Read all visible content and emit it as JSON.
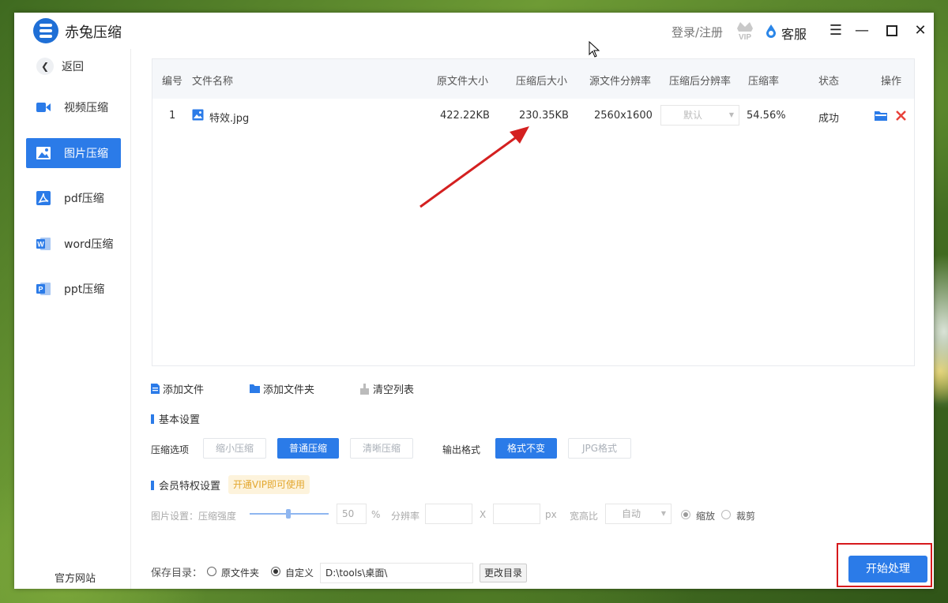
{
  "app": {
    "title": "赤兔压缩"
  },
  "header": {
    "login_label": "登录/注册",
    "vip_label": "VIP",
    "service_label": "客服"
  },
  "sidebar": {
    "back_label": "返回",
    "items": [
      {
        "label": "视频压缩",
        "icon": "video-icon"
      },
      {
        "label": "图片压缩",
        "icon": "image-icon",
        "active": true
      },
      {
        "label": "pdf压缩",
        "icon": "pdf-icon"
      },
      {
        "label": "word压缩",
        "icon": "word-icon"
      },
      {
        "label": "ppt压缩",
        "icon": "ppt-icon"
      }
    ],
    "footer_link": "官方网站"
  },
  "table": {
    "columns": [
      "编号",
      "文件名称",
      "原文件大小",
      "压缩后大小",
      "源文件分辨率",
      "压缩后分辨率",
      "压缩率",
      "状态",
      "操作"
    ],
    "rows": [
      {
        "index": "1",
        "filename": "特效.jpg",
        "original_size": "422.22KB",
        "compressed_size": "230.35KB",
        "source_resolution": "2560x1600",
        "target_resolution": "默认",
        "ratio": "54.56%",
        "status": "成功"
      }
    ]
  },
  "toolbar": {
    "add_file": "添加文件",
    "add_folder": "添加文件夹",
    "clear_list": "清空列表"
  },
  "basic_settings": {
    "title": "基本设置",
    "compress_label": "压缩选项",
    "compress_options": [
      "缩小压缩",
      "普通压缩",
      "清晰压缩"
    ],
    "compress_selected": "普通压缩",
    "format_label": "输出格式",
    "format_options": [
      "格式不变",
      "JPG格式"
    ],
    "format_selected": "格式不变"
  },
  "vip_settings": {
    "title": "会员特权设置",
    "tag": "开通VIP即可使用",
    "image_label": "图片设置：压缩强度",
    "strength_value": "50",
    "percent_unit": "%",
    "resolution_label": "分辨率",
    "x_label": "X",
    "px_unit": "px",
    "aspect_label": "宽高比",
    "aspect_value": "自动",
    "scale_label": "缩放",
    "crop_label": "裁剪",
    "slider_level": 0.5
  },
  "save": {
    "label": "保存目录：",
    "original_folder": "原文件夹",
    "custom": "自定义",
    "path": "D:\\tools\\桌面\\",
    "change_button": "更改目录"
  },
  "start_button": "开始处理",
  "colors": {
    "accent": "#2b7be8",
    "highlight": "#d6191c",
    "annotation_arrow": "#d42020"
  }
}
